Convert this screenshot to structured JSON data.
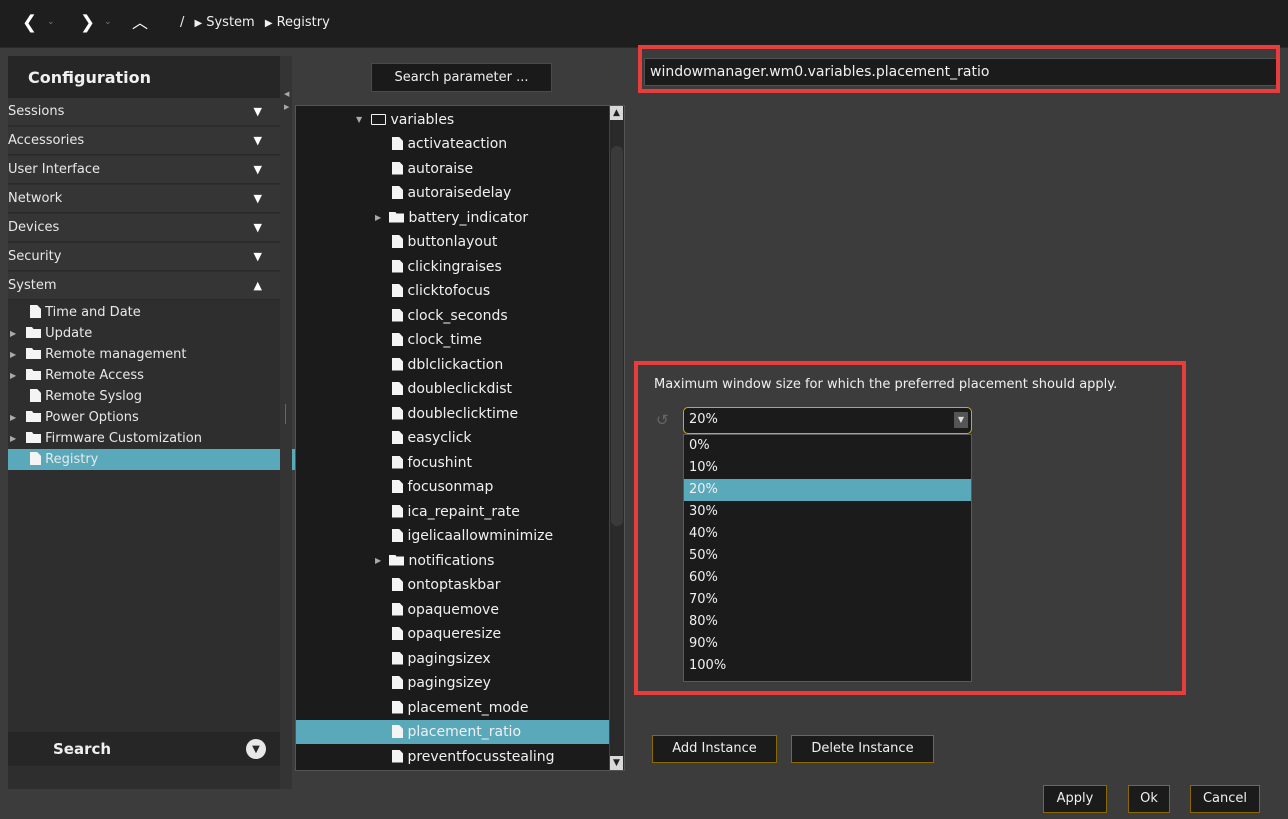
{
  "nav": {
    "back_icon": "chevron-left-icon",
    "forward_icon": "chevron-right-icon",
    "up_icon": "chevron-up-icon",
    "breadcrumb": [
      "/",
      "System",
      "Registry"
    ]
  },
  "sidebar": {
    "title": "Configuration",
    "categories": [
      {
        "label": "Sessions",
        "expanded": false
      },
      {
        "label": "Accessories",
        "expanded": false
      },
      {
        "label": "User Interface",
        "expanded": false
      },
      {
        "label": "Network",
        "expanded": false
      },
      {
        "label": "Devices",
        "expanded": false
      },
      {
        "label": "Security",
        "expanded": false
      },
      {
        "label": "System",
        "expanded": true
      }
    ],
    "system_items": [
      {
        "label": "Time and Date",
        "type": "file"
      },
      {
        "label": "Update",
        "type": "folder"
      },
      {
        "label": "Remote management",
        "type": "folder"
      },
      {
        "label": "Remote Access",
        "type": "folder"
      },
      {
        "label": "Remote Syslog",
        "type": "file"
      },
      {
        "label": "Power Options",
        "type": "folder"
      },
      {
        "label": "Firmware Customization",
        "type": "folder"
      },
      {
        "label": "Registry",
        "type": "file",
        "selected": true
      }
    ],
    "search_label": "Search"
  },
  "tree": {
    "search_button": "Search parameter ...",
    "nodes": [
      {
        "label": "variables",
        "type": "folder-open"
      },
      {
        "label": "activateaction",
        "type": "file"
      },
      {
        "label": "autoraise",
        "type": "file"
      },
      {
        "label": "autoraisedelay",
        "type": "file"
      },
      {
        "label": "battery_indicator",
        "type": "folder"
      },
      {
        "label": "buttonlayout",
        "type": "file"
      },
      {
        "label": "clickingraises",
        "type": "file"
      },
      {
        "label": "clicktofocus",
        "type": "file"
      },
      {
        "label": "clock_seconds",
        "type": "file"
      },
      {
        "label": "clock_time",
        "type": "file"
      },
      {
        "label": "dblclickaction",
        "type": "file"
      },
      {
        "label": "doubleclickdist",
        "type": "file"
      },
      {
        "label": "doubleclicktime",
        "type": "file"
      },
      {
        "label": "easyclick",
        "type": "file"
      },
      {
        "label": "focushint",
        "type": "file"
      },
      {
        "label": "focusonmap",
        "type": "file"
      },
      {
        "label": "ica_repaint_rate",
        "type": "file"
      },
      {
        "label": "igelicaallowminimize",
        "type": "file"
      },
      {
        "label": "notifications",
        "type": "folder"
      },
      {
        "label": "ontoptaskbar",
        "type": "file"
      },
      {
        "label": "opaquemove",
        "type": "file"
      },
      {
        "label": "opaqueresize",
        "type": "file"
      },
      {
        "label": "pagingsizex",
        "type": "file"
      },
      {
        "label": "pagingsizey",
        "type": "file"
      },
      {
        "label": "placement_mode",
        "type": "file"
      },
      {
        "label": "placement_ratio",
        "type": "file",
        "selected": true
      },
      {
        "label": "preventfocusstealing",
        "type": "file"
      }
    ]
  },
  "detail": {
    "path": "windowmanager.wm0.variables.placement_ratio",
    "description": "Maximum window size for which the preferred placement should apply.",
    "selected_value": "20%",
    "options": [
      "0%",
      "10%",
      "20%",
      "30%",
      "40%",
      "50%",
      "60%",
      "70%",
      "80%",
      "90%",
      "100%"
    ],
    "add_instance": "Add Instance",
    "delete_instance": "Delete Instance"
  },
  "footer": {
    "apply": "Apply",
    "ok": "Ok",
    "cancel": "Cancel"
  },
  "colors": {
    "selection": "#5aa9ba",
    "highlight_box": "#e83d3d",
    "focus_border": "#d8a800"
  }
}
